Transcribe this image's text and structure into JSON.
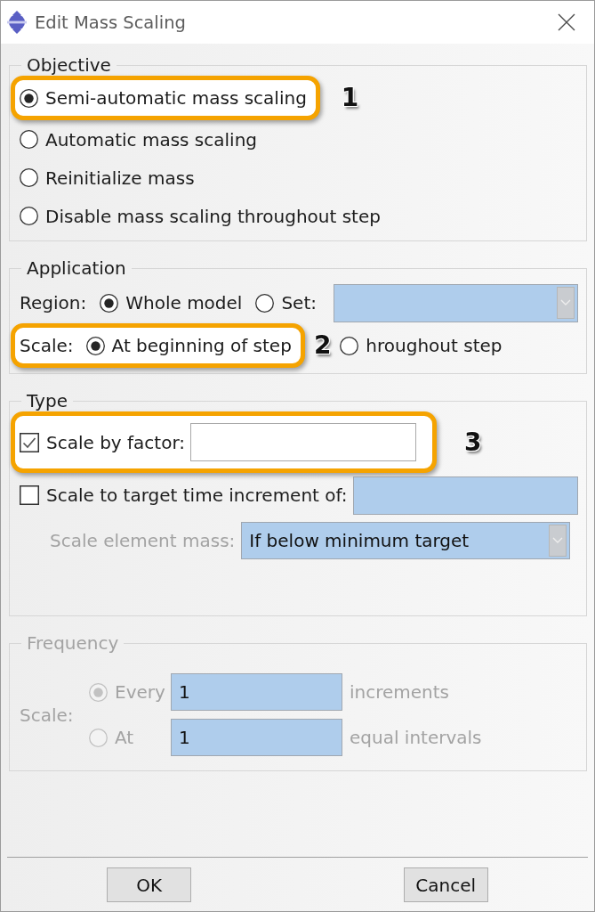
{
  "window": {
    "title": "Edit Mass Scaling"
  },
  "objective": {
    "title": "Objective",
    "options": [
      {
        "label": "Semi-automatic mass scaling",
        "selected": true,
        "callout": "1"
      },
      {
        "label": "Automatic mass scaling",
        "selected": false
      },
      {
        "label": "Reinitialize mass",
        "selected": false
      },
      {
        "label": "Disable mass scaling throughout step",
        "selected": false
      }
    ]
  },
  "application": {
    "title": "Application",
    "region": {
      "label": "Region:",
      "options": [
        {
          "label": "Whole model",
          "selected": true
        },
        {
          "label": "Set:",
          "selected": false
        }
      ],
      "set_field": {
        "disabled": true
      }
    },
    "scale": {
      "label": "Scale:",
      "callout": "2",
      "options": [
        {
          "label": "At beginning of step",
          "selected": true
        },
        {
          "label": "hroughout step",
          "selected": false
        }
      ]
    }
  },
  "type": {
    "title": "Type",
    "options": [
      {
        "label": "Scale by factor:",
        "checked": true,
        "callout": "3",
        "field": {
          "disabled": false
        }
      },
      {
        "label": "Scale to target time increment of:",
        "checked": false,
        "field": {
          "disabled": true
        }
      }
    ],
    "element_mass": {
      "label": "Scale element mass:",
      "disabled": true,
      "value": "If below minimum target"
    }
  },
  "frequency": {
    "title": "Frequency",
    "disabled": true,
    "label": "Scale:",
    "options": [
      {
        "label": "Every",
        "selected": true,
        "value": "1",
        "unit": "increments"
      },
      {
        "label": "At",
        "selected": false,
        "value": "1",
        "unit": "equal intervals"
      }
    ]
  },
  "buttons": [
    {
      "label": "OK"
    },
    {
      "label": "Cancel"
    }
  ]
}
